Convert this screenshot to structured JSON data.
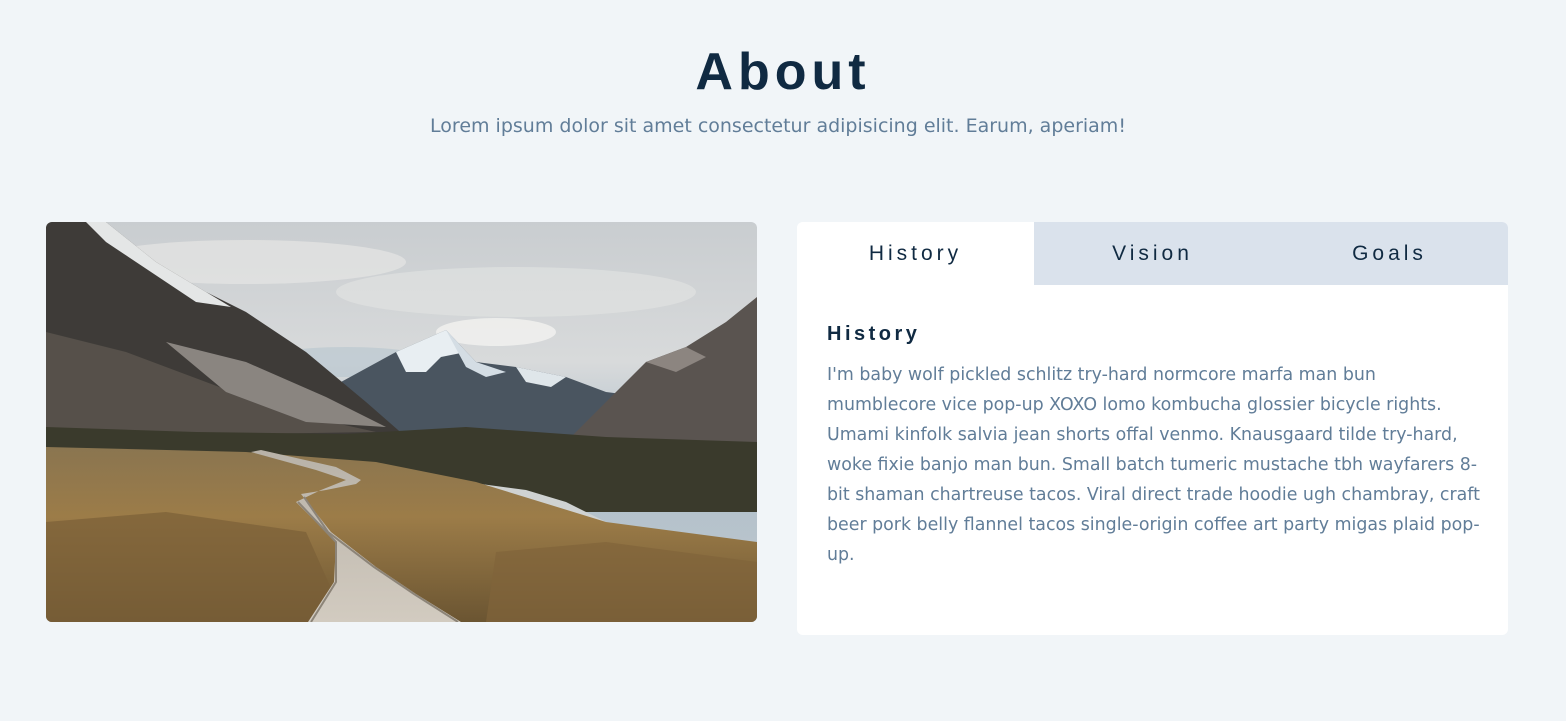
{
  "header": {
    "title": "About",
    "subtitle": "Lorem ipsum dolor sit amet consectetur adipisicing elit. Earum, aperiam!"
  },
  "image": {
    "description_icon": "mountain-landscape-photo"
  },
  "tabs": [
    {
      "label": "History",
      "active": true
    },
    {
      "label": "Vision",
      "active": false
    },
    {
      "label": "Goals",
      "active": false
    }
  ],
  "content": {
    "title": "History",
    "text": "I'm baby wolf pickled schlitz try-hard normcore marfa man bun mumblecore vice pop-up XOXO lomo kombucha glossier bicycle rights. Umami kinfolk salvia jean shorts offal venmo. Knausgaard tilde try-hard, woke fixie banjo man bun. Small batch tumeric mustache tbh wayfarers 8-bit shaman chartreuse tacos. Viral direct trade hoodie ugh chambray, craft beer pork belly flannel tacos single-origin coffee art party migas plaid pop-up."
  },
  "colors": {
    "background": "#f1f5f8",
    "title": "#102a42",
    "subtitle": "#617d98",
    "tab_inactive": "#dae2ec",
    "card": "#ffffff"
  }
}
